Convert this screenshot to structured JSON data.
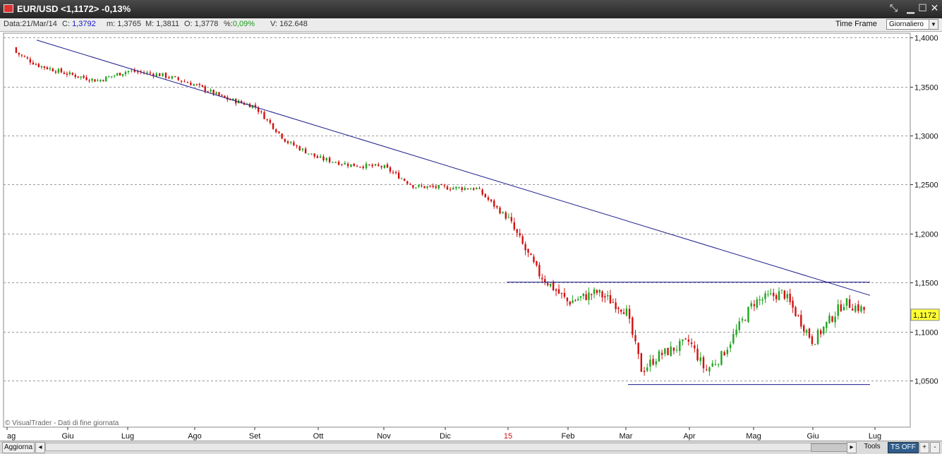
{
  "window": {
    "title": "EUR/USD <1,1172> -0,13%"
  },
  "infobar": {
    "date_label": "Data:",
    "date_value": "21/Mar/14",
    "close_label": "C:",
    "close_value": "1,3792",
    "min_label": "m:",
    "min_value": "1,3765",
    "max_label": "M:",
    "max_value": "1,3811",
    "open_label": "O:",
    "open_value": "1,3778",
    "pct_label": "%:",
    "pct_value": "0,09%",
    "vol_label": "V:",
    "vol_value": "162.648",
    "timeframe_label": "Time Frame",
    "timeframe_value": "Giornaliero"
  },
  "chart_data": {
    "type": "candlestick",
    "symbol": "EUR/USD",
    "last_price": "1,1172",
    "ylim": [
      1.0025,
      1.4045
    ],
    "y_ticks": [
      "1,4000",
      "1,3500",
      "1,3000",
      "1,2500",
      "1,2000",
      "1,1500",
      "1,1000",
      "1,0500"
    ],
    "x_ticks": [
      "ag",
      "Giu",
      "Lug",
      "Ago",
      "Set",
      "Ott",
      "Nov",
      "Dic",
      "15",
      "Feb",
      "Mar",
      "Apr",
      "Mag",
      "Giu",
      "Lug"
    ],
    "year_marker": "15",
    "grid": true,
    "watermark": "© VisualTrader - Dati di fine giornata",
    "colors": {
      "up": "#1fa51f",
      "down": "#d11111",
      "trendline": "#1a1a8a",
      "grid": "#999999",
      "last_price_bg": "#ffff33"
    },
    "series": [
      {
        "waypoints_month_index": [
          0,
          0.5,
          1,
          1.5,
          2,
          2.5,
          3,
          3.5,
          4,
          4.5,
          5,
          5.5,
          6,
          6.5,
          7,
          7.5,
          8,
          8.5,
          9,
          9.5,
          10,
          10.25,
          10.5,
          11,
          11.25,
          11.5,
          12,
          12.5,
          13,
          13.5,
          14
        ],
        "approx_close": [
          1.39,
          1.372,
          1.363,
          1.356,
          1.366,
          1.362,
          1.352,
          1.338,
          1.33,
          1.294,
          1.277,
          1.27,
          1.268,
          1.248,
          1.247,
          1.246,
          1.215,
          1.16,
          1.13,
          1.14,
          1.122,
          1.06,
          1.075,
          1.09,
          1.06,
          1.075,
          1.13,
          1.14,
          1.09,
          1.13,
          1.118
        ]
      }
    ],
    "trendlines": [
      {
        "label": "downtrend resistance",
        "from": [
          "mag 2014",
          1.3975
        ],
        "to": [
          "giu 2015",
          1.137
        ]
      },
      {
        "label": "horizontal resistance",
        "from": [
          "gen 2015",
          1.1505
        ],
        "to": [
          "giu 2015",
          1.1505
        ]
      },
      {
        "label": "horizontal support",
        "from": [
          "mar 2015",
          1.046
        ],
        "to": [
          "giu 2015",
          1.046
        ]
      }
    ]
  },
  "bottombar": {
    "refresh_label": "Aggiorna",
    "tools_label": "Tools",
    "ts_label": "TS OFF",
    "plus_label": "+",
    "minus_label": "-"
  }
}
